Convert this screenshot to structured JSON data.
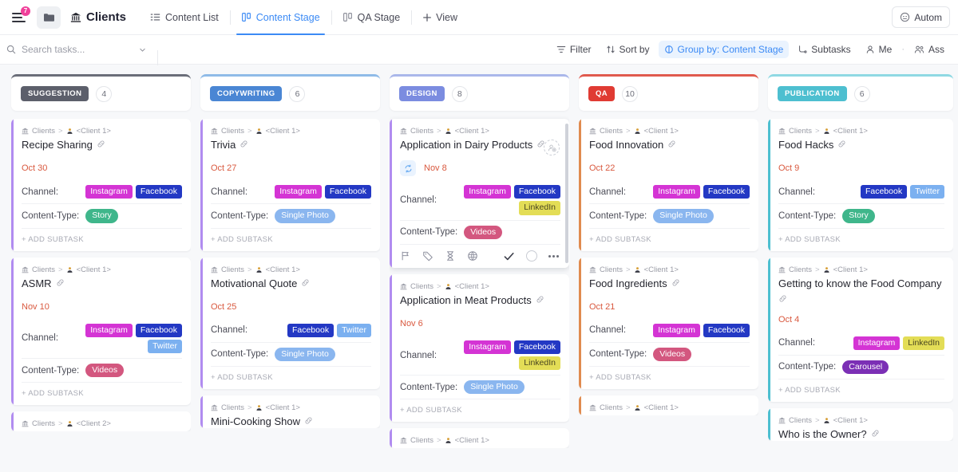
{
  "topbar": {
    "notification_count": "7",
    "hamburger_icon": "hamburger-menu-icon",
    "folder_icon": "folder-icon",
    "space_icon": "bank-icon",
    "space_name": "Clients",
    "tabs": [
      {
        "label": "Content List",
        "icon": "list-view-icon",
        "active": false
      },
      {
        "label": "Content Stage",
        "icon": "board-view-icon",
        "active": true
      },
      {
        "label": "QA Stage",
        "icon": "board-view-icon",
        "active": false
      }
    ],
    "add_view_label": "View",
    "add_view_icon": "plus-icon",
    "automations_label": "Autom",
    "automations_icon": "robot-icon"
  },
  "filterbar": {
    "search_placeholder": "Search tasks...",
    "search_value": "",
    "search_icon": "search-icon",
    "search_chevron_icon": "chevron-down-icon",
    "items": [
      {
        "label": "Filter",
        "icon": "filter-icon",
        "highlight": false
      },
      {
        "label": "Sort by",
        "icon": "sort-icon",
        "highlight": false
      },
      {
        "label": "Group by: Content Stage",
        "icon": "group-icon",
        "highlight": true
      },
      {
        "label": "Subtasks",
        "icon": "subtasks-icon",
        "highlight": false
      },
      {
        "label": "Me",
        "icon": "person-icon",
        "highlight": false
      },
      {
        "label": "Ass",
        "icon": "people-icon",
        "highlight": false
      }
    ],
    "separator": "·"
  },
  "colors": {
    "suggestion": "#5c5f6b",
    "copywriting": "#4a86d4",
    "design": "#7b8ce0",
    "qa": "#e03b33",
    "publication": "#4dbfd0",
    "instagram": "#d434d4",
    "facebook": "#2338c4",
    "twitter": "#7bb0f0",
    "linkedin": "#e3dd56",
    "story": "#3fb68b",
    "single_photo": "#8ab6ef",
    "videos": "#d3577f",
    "carousel": "#7b2fb5",
    "accent_purple": "#b18cf0",
    "accent_orange": "#e08b4f",
    "accent_teal": "#4dbfd0",
    "date_red": "#d9593f",
    "link_blue": "#3b8af5"
  },
  "labels": {
    "channel": "Channel:",
    "content_type": "Content-Type:",
    "add_subtask": "+ ADD SUBTASK",
    "crumb_root": "Clients",
    "crumb_sep": ">"
  },
  "columns": [
    {
      "stage": "SUGGESTION",
      "count": "4",
      "stage_color": "#5c5f6b",
      "top_border": "#6b6e79",
      "accent": "#b18cf0",
      "cards": [
        {
          "crumb_client": "<Client 1>",
          "title": "Recipe Sharing",
          "date": "Oct 30",
          "channels": [
            {
              "name": "Instagram",
              "color": "#d434d4"
            },
            {
              "name": "Facebook",
              "color": "#2338c4"
            }
          ],
          "content_type": {
            "name": "Story",
            "color": "#3fb68b"
          }
        },
        {
          "crumb_client": "<Client 1>",
          "title": "ASMR",
          "date": "Nov 10",
          "channels": [
            {
              "name": "Instagram",
              "color": "#d434d4"
            },
            {
              "name": "Facebook",
              "color": "#2338c4"
            },
            {
              "name": "Twitter",
              "color": "#7bb0f0"
            }
          ],
          "content_type": {
            "name": "Videos",
            "color": "#d3577f"
          }
        },
        {
          "crumb_client": "<Client 2>",
          "clipped": true
        }
      ]
    },
    {
      "stage": "COPYWRITING",
      "count": "6",
      "stage_color": "#4a86d4",
      "top_border": "#8fbbe8",
      "accent": "#b18cf0",
      "cards": [
        {
          "crumb_client": "<Client 1>",
          "title": "Trivia",
          "date": "Oct 27",
          "channels": [
            {
              "name": "Instagram",
              "color": "#d434d4"
            },
            {
              "name": "Facebook",
              "color": "#2338c4"
            }
          ],
          "content_type": {
            "name": "Single Photo",
            "color": "#8ab6ef"
          }
        },
        {
          "crumb_client": "<Client 1>",
          "title": "Motivational Quote",
          "date": "Oct 25",
          "channels": [
            {
              "name": "Facebook",
              "color": "#2338c4"
            },
            {
              "name": "Twitter",
              "color": "#7bb0f0"
            }
          ],
          "content_type": {
            "name": "Single Photo",
            "color": "#8ab6ef"
          }
        },
        {
          "crumb_client": "<Client 1>",
          "title": "Mini-Cooking Show",
          "clipped": true
        }
      ]
    },
    {
      "stage": "DESIGN",
      "count": "8",
      "stage_color": "#7b8ce0",
      "top_border": "#aab7ea",
      "accent": "#b18cf0",
      "cards": [
        {
          "crumb_client": "<Client 1>",
          "title": "Application in Dairy Products",
          "date": "Nov 8",
          "recurring": true,
          "hovered": true,
          "channels": [
            {
              "name": "Instagram",
              "color": "#d434d4"
            },
            {
              "name": "Facebook",
              "color": "#2338c4"
            },
            {
              "name": "LinkedIn",
              "color": "#e3dd56"
            }
          ],
          "content_type": {
            "name": "Videos",
            "color": "#d3577f"
          },
          "toolbar_icons": [
            "flag-icon",
            "tag-icon",
            "hourglass-icon",
            "globe-icon",
            "check-icon",
            "circle-icon",
            "more-options-icon"
          ]
        },
        {
          "crumb_client": "<Client 1>",
          "title": "Application in Meat Products",
          "date": "Nov 6",
          "channels": [
            {
              "name": "Instagram",
              "color": "#d434d4"
            },
            {
              "name": "Facebook",
              "color": "#2338c4"
            },
            {
              "name": "LinkedIn",
              "color": "#e3dd56"
            }
          ],
          "content_type": {
            "name": "Single Photo",
            "color": "#8ab6ef"
          }
        },
        {
          "crumb_client": "<Client 1>",
          "clipped": true
        }
      ]
    },
    {
      "stage": "QA",
      "count": "10",
      "stage_color": "#e03b33",
      "top_border": "#e05a4e",
      "accent": "#e08b4f",
      "cards": [
        {
          "crumb_client": "<Client 1>",
          "title": "Food Innovation",
          "date": "Oct 22",
          "channels": [
            {
              "name": "Instagram",
              "color": "#d434d4"
            },
            {
              "name": "Facebook",
              "color": "#2338c4"
            }
          ],
          "content_type": {
            "name": "Single Photo",
            "color": "#8ab6ef"
          }
        },
        {
          "crumb_client": "<Client 1>",
          "title": "Food Ingredients",
          "date": "Oct 21",
          "channels": [
            {
              "name": "Instagram",
              "color": "#d434d4"
            },
            {
              "name": "Facebook",
              "color": "#2338c4"
            }
          ],
          "content_type": {
            "name": "Videos",
            "color": "#d3577f"
          }
        },
        {
          "crumb_client": "<Client 1>",
          "clipped": true
        }
      ]
    },
    {
      "stage": "PUBLICATION",
      "count": "6",
      "stage_color": "#4dbfd0",
      "top_border": "#8fd9e3",
      "accent": "#4dbfd0",
      "cards": [
        {
          "crumb_client": "<Client 1>",
          "title": "Food Hacks",
          "date": "Oct 9",
          "channels": [
            {
              "name": "Facebook",
              "color": "#2338c4"
            },
            {
              "name": "Twitter",
              "color": "#7bb0f0"
            }
          ],
          "content_type": {
            "name": "Story",
            "color": "#3fb68b"
          }
        },
        {
          "crumb_client": "<Client 1>",
          "title": "Getting to know the Food Company",
          "date": "Oct 4",
          "channels": [
            {
              "name": "Instagram",
              "color": "#d434d4"
            },
            {
              "name": "LinkedIn",
              "color": "#e3dd56"
            }
          ],
          "content_type": {
            "name": "Carousel",
            "color": "#7b2fb5"
          }
        },
        {
          "crumb_client": "<Client 1>",
          "title": "Who is the Owner?",
          "clipped": true
        }
      ]
    }
  ]
}
